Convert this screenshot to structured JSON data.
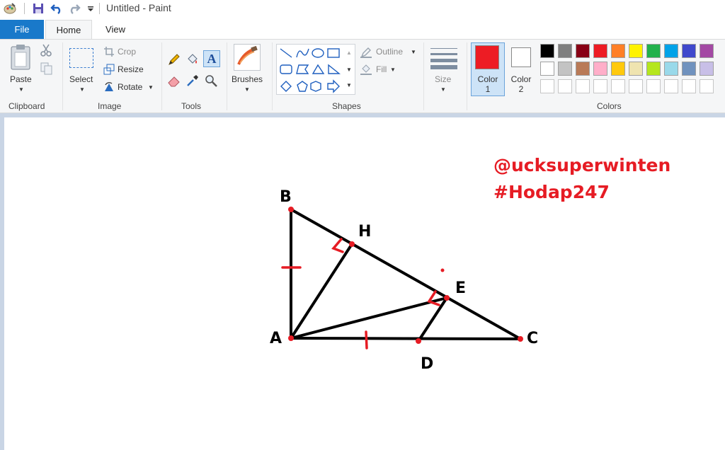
{
  "window": {
    "title": "Untitled - Paint"
  },
  "tabs": {
    "file": "File",
    "home": "Home",
    "view": "View"
  },
  "clipboard": {
    "paste": "Paste",
    "group": "Clipboard"
  },
  "image": {
    "select": "Select",
    "crop": "Crop",
    "resize": "Resize",
    "rotate": "Rotate",
    "group": "Image"
  },
  "tools": {
    "group": "Tools"
  },
  "brushes": {
    "label": "Brushes"
  },
  "shapes": {
    "outline": "Outline",
    "fill": "Fill",
    "group": "Shapes"
  },
  "size": {
    "label": "Size"
  },
  "colors": {
    "color1": "Color 1",
    "color2": "Color 2",
    "group": "Colors",
    "color1_value": "#ed1c24",
    "color2_value": "#ffffff",
    "palette_row1": [
      "#000000",
      "#7f7f7f",
      "#880015",
      "#ed1c24",
      "#ff7f27",
      "#fff200",
      "#22b14c",
      "#00a2e8",
      "#3f48cc",
      "#a349a4"
    ],
    "palette_row2": [
      "#ffffff",
      "#c3c3c3",
      "#b97a57",
      "#ffaec9",
      "#ffc90e",
      "#efe4b0",
      "#b5e61d",
      "#99d9ea",
      "#7092be",
      "#c8bfe7"
    ]
  },
  "drawing": {
    "watermark_line1": "@ucksuperwinten",
    "watermark_line2": "#Hodap247",
    "labels": {
      "A": "A",
      "B": "B",
      "C": "C",
      "D": "D",
      "E": "E",
      "H": "H"
    }
  }
}
